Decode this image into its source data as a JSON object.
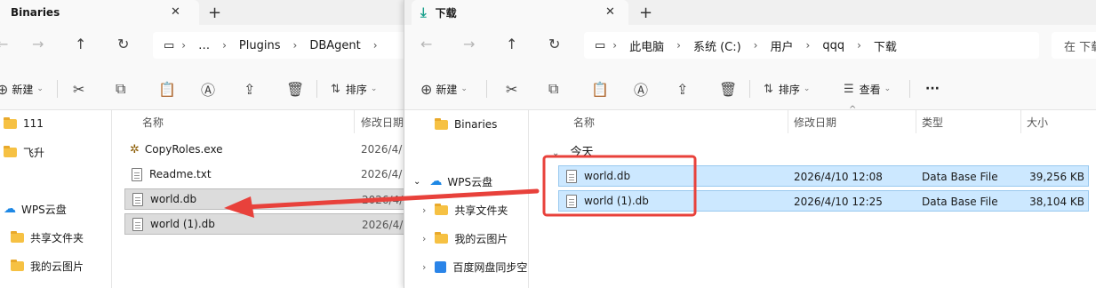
{
  "left_window": {
    "tab_title": "Binaries",
    "tab_close": "✕",
    "new_tab": "+",
    "address": [
      "…",
      "Plugins",
      "DBAgent"
    ],
    "toolbar": {
      "new_label": "新建",
      "sort_label": "排序"
    },
    "nav_items": [
      "111",
      "飞升",
      "WPS云盘",
      "共享文件夹",
      "我的云图片"
    ],
    "columns": {
      "name": "名称",
      "modified": "修改日期"
    },
    "files": [
      {
        "name": "CopyRoles.exe",
        "date": "2026/4/"
      },
      {
        "name": "Readme.txt",
        "date": "2026/4/"
      },
      {
        "name": "world.db",
        "date": "2026/4/"
      },
      {
        "name": "world (1).db",
        "date": "2026/4/"
      }
    ]
  },
  "right_window": {
    "tab_title": "下载",
    "tab_close": "✕",
    "new_tab": "+",
    "address": [
      "此电脑",
      "系统 (C:)",
      "用户",
      "qqq",
      "下载"
    ],
    "search_placeholder": "在 下载",
    "toolbar": {
      "new_label": "新建",
      "sort_label": "排序",
      "view_label": "查看",
      "more": "···"
    },
    "nav_items": [
      "Binaries",
      "WPS云盘",
      "共享文件夹",
      "我的云图片",
      "百度网盘同步空"
    ],
    "columns": {
      "name": "名称",
      "modified": "修改日期",
      "type": "类型",
      "size": "大小"
    },
    "group_label": "今天",
    "files": [
      {
        "name": "world.db",
        "date": "2026/4/10 12:08",
        "type": "Data Base File",
        "size": "39,256 KB"
      },
      {
        "name": "world (1).db",
        "date": "2026/4/10 12:25",
        "type": "Data Base File",
        "size": "38,104 KB"
      }
    ]
  },
  "colors": {
    "selection": "#cce8ff",
    "selection_border": "#0067c0",
    "annotation": "#e8413b",
    "left_selected": "#dcdcdc"
  },
  "icons": [
    "arrow-left-icon",
    "arrow-right-icon",
    "arrow-up-icon",
    "refresh-icon",
    "monitor-icon",
    "cut-icon",
    "copy-icon",
    "paste-icon",
    "rename-icon",
    "share-icon",
    "delete-icon",
    "sort-icon",
    "view-icon",
    "download-icon",
    "folder-icon",
    "cloud-icon",
    "file-db-icon"
  ]
}
